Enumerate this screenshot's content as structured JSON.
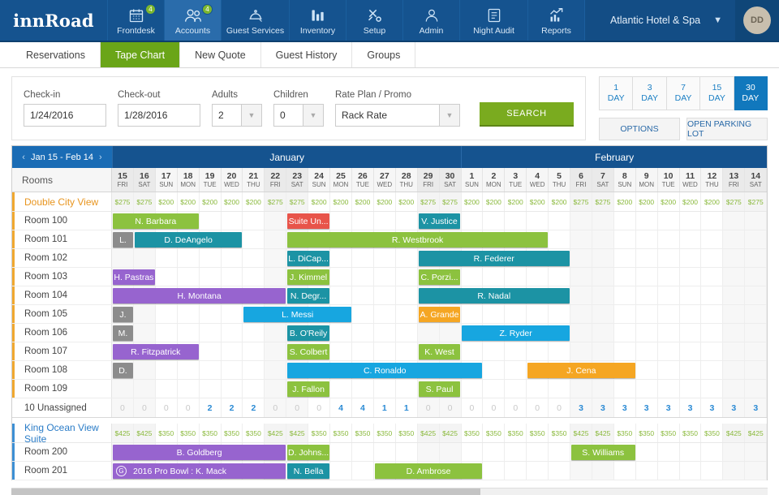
{
  "brand": "innRoad",
  "topnav": {
    "items": [
      {
        "label": "Frontdesk",
        "icon": "calendar-icon",
        "badge": "4",
        "active": false
      },
      {
        "label": "Accounts",
        "icon": "users-icon",
        "badge": "4",
        "active": true
      },
      {
        "label": "Guest Services",
        "icon": "bell-service-icon",
        "badge": null,
        "active": false,
        "wide": true
      },
      {
        "label": "Inventory",
        "icon": "bar-chart-icon",
        "badge": null,
        "active": false
      },
      {
        "label": "Setup",
        "icon": "tools-icon",
        "badge": null,
        "active": false
      },
      {
        "label": "Admin",
        "icon": "person-icon",
        "badge": null,
        "active": false
      },
      {
        "label": "Night Audit",
        "icon": "checklist-icon",
        "badge": null,
        "active": false,
        "wide": true
      },
      {
        "label": "Reports",
        "icon": "trend-chart-icon",
        "badge": null,
        "active": false
      }
    ],
    "property": "Atlantic Hotel &  Spa",
    "user_initials": "DD"
  },
  "subtabs": [
    {
      "label": "Reservations",
      "active": false
    },
    {
      "label": "Tape Chart",
      "active": true
    },
    {
      "label": "New Quote",
      "active": false
    },
    {
      "label": "Guest History",
      "active": false
    },
    {
      "label": "Groups",
      "active": false
    }
  ],
  "search": {
    "checkin_label": "Check-in",
    "checkin_value": "1/24/2016",
    "checkout_label": "Check-out",
    "checkout_value": "1/28/2016",
    "adults_label": "Adults",
    "adults_value": "2",
    "children_label": "Children",
    "children_value": "0",
    "rate_label": "Rate Plan / Promo",
    "rate_value": "Rack Rate",
    "search_button": "SEARCH"
  },
  "daybuttons": [
    {
      "num": "1",
      "unit": "DAY",
      "active": false
    },
    {
      "num": "3",
      "unit": "DAY",
      "active": false
    },
    {
      "num": "7",
      "unit": "DAY",
      "active": false
    },
    {
      "num": "15",
      "unit": "DAY",
      "active": false
    },
    {
      "num": "30",
      "unit": "DAY",
      "active": true
    }
  ],
  "options_button": "OPTIONS",
  "parking_button": "OPEN PARKING LOT",
  "chart": {
    "range_label": "Jan 15 - Feb 14",
    "prev_arrow": "‹",
    "next_arrow": "›",
    "rooms_header": "Rooms",
    "months": [
      {
        "name": "January",
        "span": 16
      },
      {
        "name": "February",
        "span": 14
      }
    ],
    "days": [
      {
        "num": "15",
        "dow": "FRI",
        "weekend": true
      },
      {
        "num": "16",
        "dow": "SAT",
        "weekend": true
      },
      {
        "num": "17",
        "dow": "SUN",
        "weekend": false
      },
      {
        "num": "18",
        "dow": "MON",
        "weekend": false
      },
      {
        "num": "19",
        "dow": "TUE",
        "weekend": false
      },
      {
        "num": "20",
        "dow": "WED",
        "weekend": false
      },
      {
        "num": "21",
        "dow": "THU",
        "weekend": false
      },
      {
        "num": "22",
        "dow": "FRI",
        "weekend": true
      },
      {
        "num": "23",
        "dow": "SAT",
        "weekend": true
      },
      {
        "num": "24",
        "dow": "SUN",
        "weekend": false
      },
      {
        "num": "25",
        "dow": "MON",
        "weekend": false
      },
      {
        "num": "26",
        "dow": "TUE",
        "weekend": false
      },
      {
        "num": "27",
        "dow": "WED",
        "weekend": false
      },
      {
        "num": "28",
        "dow": "THU",
        "weekend": false
      },
      {
        "num": "29",
        "dow": "FRI",
        "weekend": true
      },
      {
        "num": "30",
        "dow": "SAT",
        "weekend": true
      },
      {
        "num": "1",
        "dow": "SUN",
        "weekend": false
      },
      {
        "num": "2",
        "dow": "MON",
        "weekend": false
      },
      {
        "num": "3",
        "dow": "TUE",
        "weekend": false
      },
      {
        "num": "4",
        "dow": "WED",
        "weekend": false
      },
      {
        "num": "5",
        "dow": "THU",
        "weekend": false
      },
      {
        "num": "6",
        "dow": "FRI",
        "weekend": true
      },
      {
        "num": "7",
        "dow": "SAT",
        "weekend": true
      },
      {
        "num": "8",
        "dow": "SUN",
        "weekend": false
      },
      {
        "num": "9",
        "dow": "MON",
        "weekend": false
      },
      {
        "num": "10",
        "dow": "TUE",
        "weekend": false
      },
      {
        "num": "11",
        "dow": "WED",
        "weekend": false
      },
      {
        "num": "12",
        "dow": "THU",
        "weekend": false
      },
      {
        "num": "13",
        "dow": "FRI",
        "weekend": true
      },
      {
        "num": "14",
        "dow": "SAT",
        "weekend": true
      }
    ],
    "sections": [
      {
        "name": "Double City View",
        "accent": "orange",
        "rates": [
          "$275",
          "$275",
          "$200",
          "$200",
          "$200",
          "$200",
          "$200",
          "$275",
          "$275",
          "$200",
          "$200",
          "$200",
          "$200",
          "$200",
          "$275",
          "$275",
          "$200",
          "$200",
          "$200",
          "$200",
          "$200",
          "$275",
          "$275",
          "$200",
          "$200",
          "$200",
          "$200",
          "$200",
          "$275",
          "$275"
        ],
        "rooms": [
          {
            "name": "Room 100",
            "bars": [
              {
                "label": "N. Barbara",
                "start": 0,
                "span": 4,
                "color": "#8cc23f"
              },
              {
                "label": "Suite Un...",
                "start": 8,
                "span": 2,
                "color": "#e8544a"
              },
              {
                "label": "V. Justice",
                "start": 14,
                "span": 2,
                "color": "#1c93a4"
              }
            ]
          },
          {
            "name": "Room 101",
            "bars": [
              {
                "label": "L.",
                "start": 0,
                "span": 1,
                "color": "#8c8c8c"
              },
              {
                "label": "D. DeAngelo",
                "start": 1,
                "span": 5,
                "color": "#1c93a4"
              },
              {
                "label": "R. Westbrook",
                "start": 8,
                "span": 12,
                "color": "#8cc23f"
              }
            ]
          },
          {
            "name": "Room 102",
            "bars": [
              {
                "label": "L. DiCap...",
                "start": 8,
                "span": 2,
                "color": "#1c93a4"
              },
              {
                "label": "R. Federer",
                "start": 14,
                "span": 7,
                "color": "#1c93a4"
              }
            ]
          },
          {
            "name": "Room 103",
            "bars": [
              {
                "label": "H. Pastras",
                "start": 0,
                "span": 2,
                "color": "#9764cf"
              },
              {
                "label": "J. Kimmel",
                "start": 8,
                "span": 2,
                "color": "#8cc23f"
              },
              {
                "label": "C. Porzi...",
                "start": 14,
                "span": 2,
                "color": "#8cc23f"
              }
            ]
          },
          {
            "name": "Room 104",
            "bars": [
              {
                "label": "H. Montana",
                "start": 0,
                "span": 8,
                "color": "#9764cf"
              },
              {
                "label": "N. Degr...",
                "start": 8,
                "span": 2,
                "color": "#1c93a4"
              },
              {
                "label": "R. Nadal",
                "start": 14,
                "span": 7,
                "color": "#1c93a4"
              }
            ]
          },
          {
            "name": "Room 105",
            "bars": [
              {
                "label": "J.",
                "start": 0,
                "span": 1,
                "color": "#8c8c8c"
              },
              {
                "label": "L. Messi",
                "start": 6,
                "span": 5,
                "color": "#17a6e0"
              },
              {
                "label": "A. Grande",
                "start": 14,
                "span": 2,
                "color": "#f5a623"
              }
            ]
          },
          {
            "name": "Room 106",
            "bars": [
              {
                "label": "M.",
                "start": 0,
                "span": 1,
                "color": "#8c8c8c"
              },
              {
                "label": "B. O'Reily",
                "start": 8,
                "span": 2,
                "color": "#1c93a4"
              },
              {
                "label": "Z. Ryder",
                "start": 16,
                "span": 5,
                "color": "#17a6e0"
              }
            ]
          },
          {
            "name": "Room 107",
            "bars": [
              {
                "label": "R. Fitzpatrick",
                "start": 0,
                "span": 4,
                "color": "#9764cf"
              },
              {
                "label": "S. Colbert",
                "start": 8,
                "span": 2,
                "color": "#8cc23f"
              },
              {
                "label": "K. West",
                "start": 14,
                "span": 2,
                "color": "#8cc23f"
              }
            ]
          },
          {
            "name": "Room 108",
            "bars": [
              {
                "label": "D.",
                "start": 0,
                "span": 1,
                "color": "#8c8c8c"
              },
              {
                "label": "C. Ronaldo",
                "start": 8,
                "span": 9,
                "color": "#17a6e0"
              },
              {
                "label": "J. Cena",
                "start": 19,
                "span": 5,
                "color": "#f5a623"
              }
            ]
          },
          {
            "name": "Room 109",
            "bars": [
              {
                "label": "J. Fallon",
                "start": 8,
                "span": 2,
                "color": "#8cc23f"
              },
              {
                "label": "S. Paul",
                "start": 14,
                "span": 2,
                "color": "#8cc23f"
              }
            ]
          }
        ],
        "unassigned_label": "10 Unassigned",
        "unassigned": [
          "0",
          "0",
          "0",
          "0",
          "2",
          "2",
          "2",
          "0",
          "0",
          "0",
          "4",
          "4",
          "1",
          "1",
          "0",
          "0",
          "0",
          "0",
          "0",
          "0",
          "0",
          "3",
          "3",
          "3",
          "3",
          "3",
          "3",
          "3",
          "3",
          "3"
        ]
      },
      {
        "name": "King Ocean View Suite",
        "accent": "blue",
        "rates": [
          "$425",
          "$425",
          "$350",
          "$350",
          "$350",
          "$350",
          "$350",
          "$425",
          "$425",
          "$350",
          "$350",
          "$350",
          "$350",
          "$350",
          "$425",
          "$425",
          "$350",
          "$350",
          "$350",
          "$350",
          "$350",
          "$425",
          "$425",
          "$350",
          "$350",
          "$350",
          "$350",
          "$350",
          "$425",
          "$425"
        ],
        "rooms": [
          {
            "name": "Room 200",
            "bars": [
              {
                "label": "B. Goldberg",
                "start": 0,
                "span": 8,
                "color": "#9764cf"
              },
              {
                "label": "D. Johns...",
                "start": 8,
                "span": 2,
                "color": "#8cc23f"
              },
              {
                "label": "S. Williams",
                "start": 21,
                "span": 3,
                "color": "#8cc23f"
              }
            ]
          },
          {
            "name": "Room 201",
            "bars": [
              {
                "label": "2016 Pro Bowl : K. Mack",
                "start": 0,
                "span": 8,
                "color": "#9764cf",
                "icon": "G"
              },
              {
                "label": "N. Bella",
                "start": 8,
                "span": 2,
                "color": "#1c93a4"
              },
              {
                "label": "D. Ambrose",
                "start": 12,
                "span": 5,
                "color": "#8cc23f"
              }
            ]
          }
        ],
        "unassigned_label": null,
        "unassigned": null
      }
    ]
  }
}
